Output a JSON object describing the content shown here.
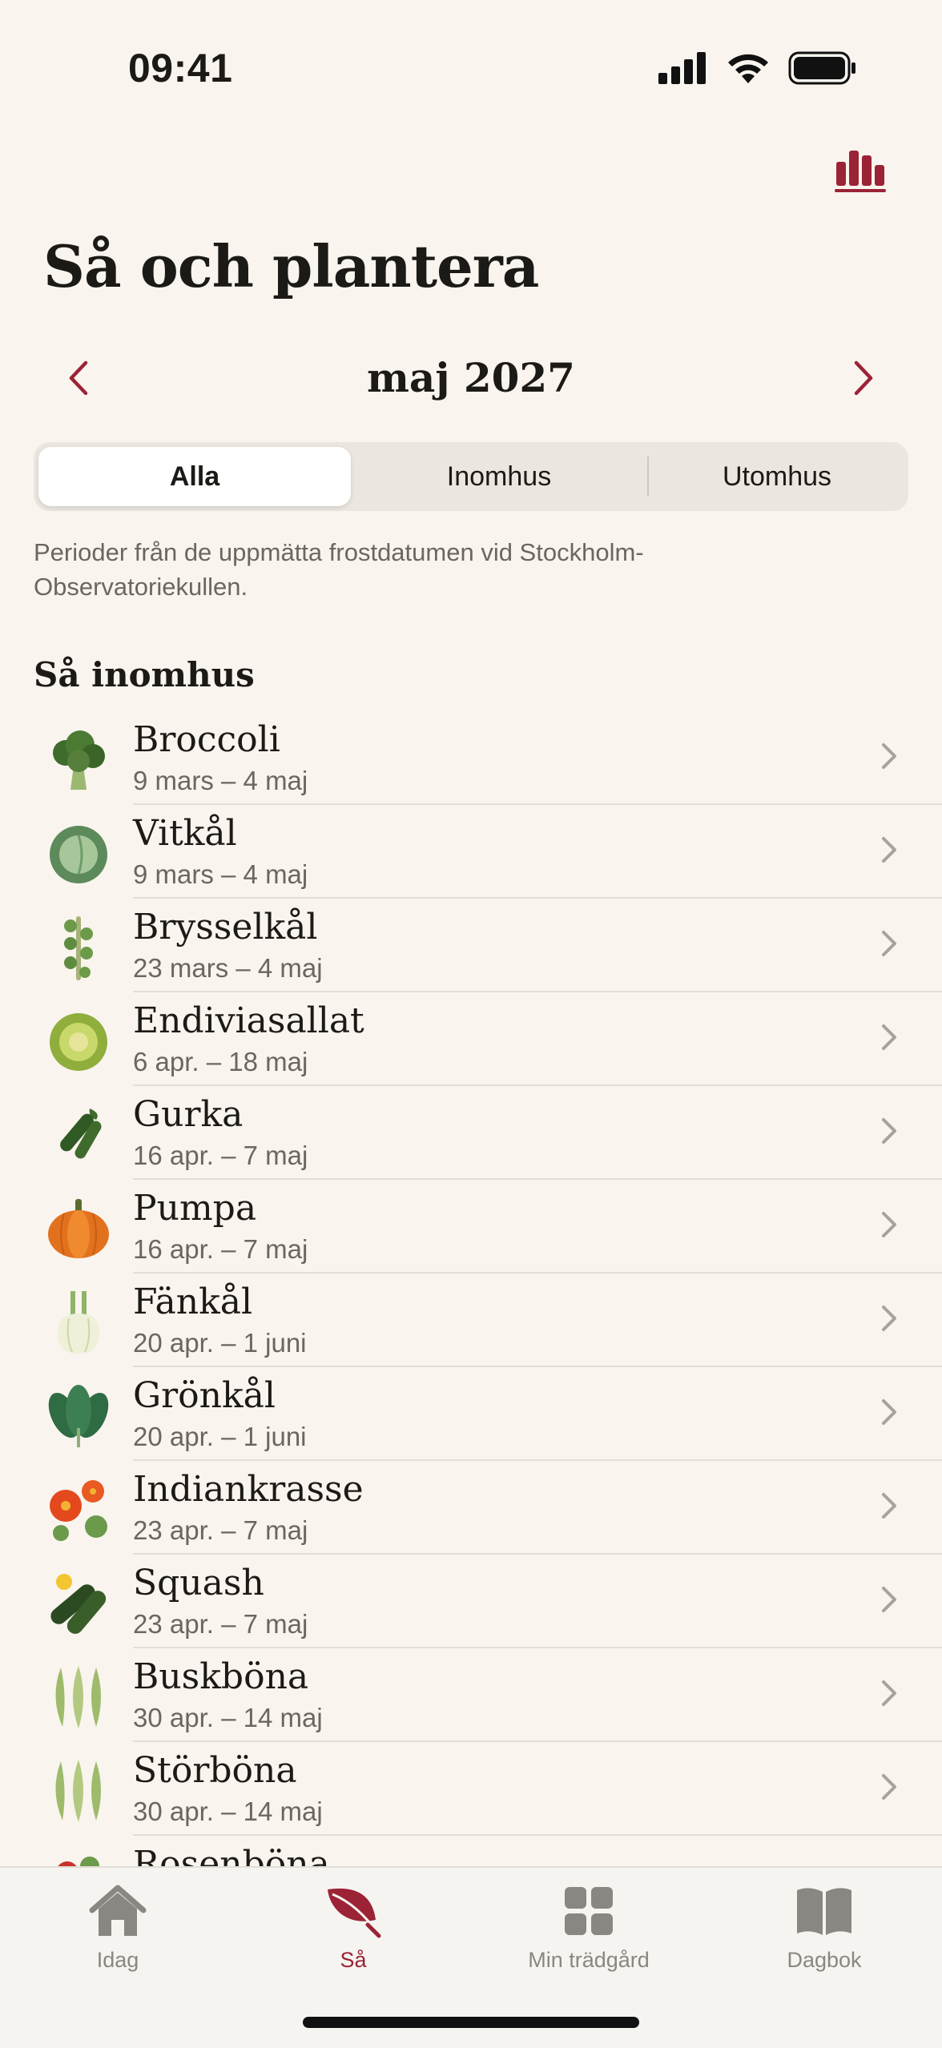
{
  "status": {
    "time": "09:41"
  },
  "header": {
    "title": "Så och plantera",
    "month": "maj 2027"
  },
  "segments": [
    "Alla",
    "Inomhus",
    "Utomhus"
  ],
  "note": "Perioder från de uppmätta frostdatumen vid Stockholm-Observatoriekullen.",
  "section": {
    "title": "Så inomhus"
  },
  "plants": [
    {
      "name": "Broccoli",
      "date": "9 mars – 4 maj",
      "icon": "broccoli-icon"
    },
    {
      "name": "Vitkål",
      "date": "9 mars – 4 maj",
      "icon": "cabbage-icon"
    },
    {
      "name": "Brysselkål",
      "date": "23 mars – 4 maj",
      "icon": "brussels-sprouts-icon"
    },
    {
      "name": "Endiviasallat",
      "date": "6 apr. – 18 maj",
      "icon": "endive-icon"
    },
    {
      "name": "Gurka",
      "date": "16 apr. – 7 maj",
      "icon": "cucumber-icon"
    },
    {
      "name": "Pumpa",
      "date": "16 apr. – 7 maj",
      "icon": "pumpkin-icon"
    },
    {
      "name": "Fänkål",
      "date": "20 apr. – 1 juni",
      "icon": "fennel-icon"
    },
    {
      "name": "Grönkål",
      "date": "20 apr. – 1 juni",
      "icon": "kale-icon"
    },
    {
      "name": "Indiankrasse",
      "date": "23 apr. – 7 maj",
      "icon": "nasturtium-icon"
    },
    {
      "name": "Squash",
      "date": "23 apr. – 7 maj",
      "icon": "zucchini-icon"
    },
    {
      "name": "Buskböna",
      "date": "30 apr. – 14 maj",
      "icon": "bean-icon"
    },
    {
      "name": "Störböna",
      "date": "30 apr. – 14 maj",
      "icon": "bean-icon"
    },
    {
      "name": "Rosenböna",
      "date": "",
      "icon": "runner-bean-icon"
    }
  ],
  "tabs": [
    {
      "label": "Idag",
      "icon": "house-icon"
    },
    {
      "label": "Så",
      "icon": "leaf-icon",
      "active": true
    },
    {
      "label": "Min trädgård",
      "icon": "grid-icon"
    },
    {
      "label": "Dagbok",
      "icon": "book-icon"
    }
  ],
  "colors": {
    "accent": "#9b2335",
    "background": "#f9f4ee",
    "secondary_text": "#6b6661"
  }
}
